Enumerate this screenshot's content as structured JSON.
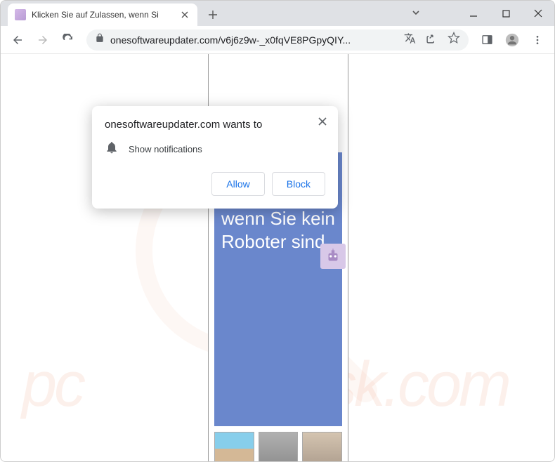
{
  "tab": {
    "title": "Klicken Sie auf Zulassen, wenn Si"
  },
  "url": {
    "display": "onesoftwareupdater.com/v6j6z9w-_x0fqVE8PGpyQIY..."
  },
  "permission": {
    "site_wants": "onesoftwareupdater.com wants to",
    "capability": "Show notifications",
    "allow": "Allow",
    "block": "Block"
  },
  "page": {
    "headline": "Klicken Sie auf Zulassen, wenn Sie kein Roboter sind"
  },
  "watermark": {
    "brand_left": "pc",
    "brand_right": "risk.com"
  }
}
